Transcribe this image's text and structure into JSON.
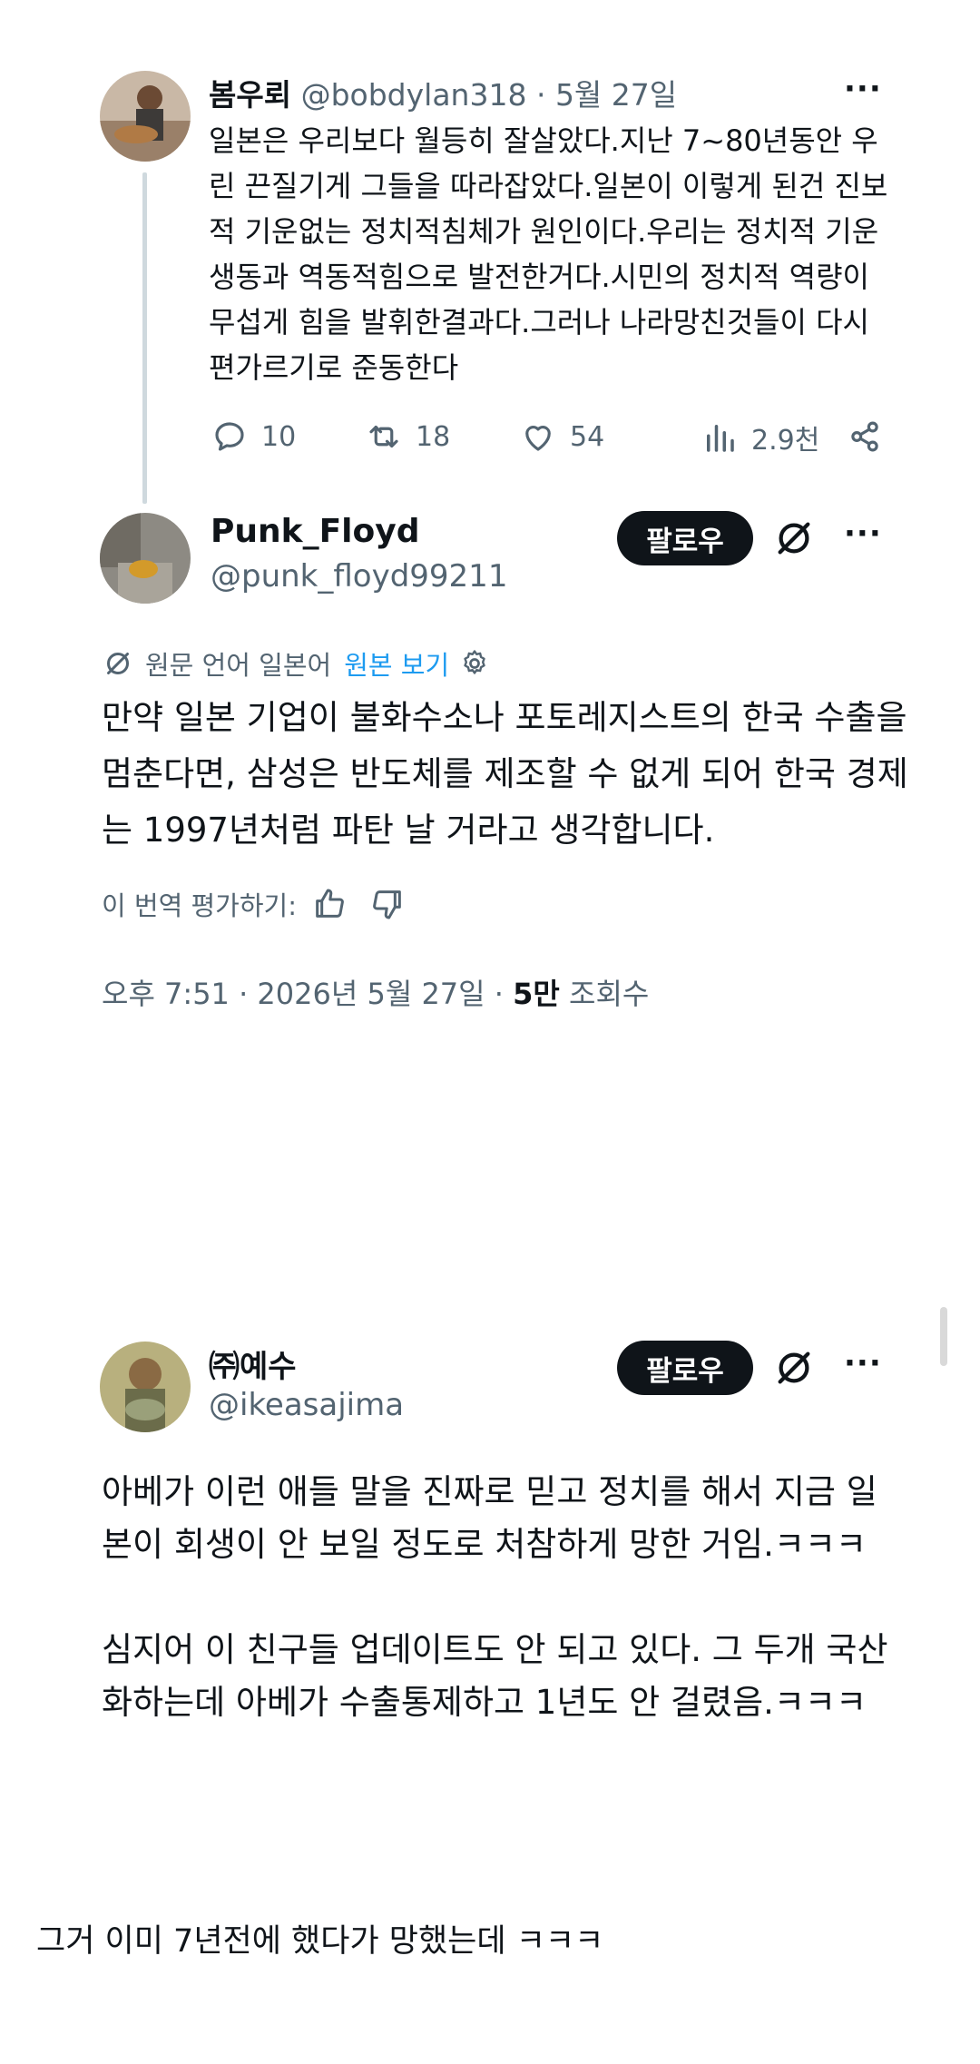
{
  "tweet1": {
    "name": "봄우뢰",
    "handle": "@bobdylan318",
    "date": "5월 27일",
    "body": "일본은 우리보다 월등히 잘살았다.지난 7~80년동안 우린 끈질기게 그들을 따라잡았다.일본이 이렇게 된건 진보적 기운없는 정치적침체가 원인이다.우리는 정치적 기운생동과 역동적힘으로 발전한거다.시민의 정치적 역량이 무섭게 힘을 발휘한결과다.그러나 나라망친것들이 다시 편가르기로 준동한다",
    "replies": "10",
    "reposts": "18",
    "likes": "54",
    "views": "2.9천"
  },
  "tweet2": {
    "name": "Punk_Floyd",
    "handle": "@punk_floyd99211",
    "follow_label": "팔로우",
    "translated_label": "원문 언어 일본어",
    "show_original": "원본 보기",
    "body": "만약 일본 기업이 불화수소나 포토레지스트의 한국 수출을 멈춘다면, 삼성은 반도체를 제조할 수 없게 되어 한국 경제는 1997년처럼 파탄 날 거라고 생각합니다.",
    "rate_label": "이 번역 평가하기:",
    "time": "오후 7:51 · 2026년 5월 27일 · ",
    "views_count": "5만",
    "views_label": "조회수"
  },
  "tweet3": {
    "name": "㈜예수",
    "handle": "@ikeasajima",
    "follow_label": "팔로우",
    "body": "아베가 이런 애들 말을 진짜로 믿고 정치를 해서 지금 일본이 회생이 안 보일 정도로 처참하게 망한 거임.ㅋㅋㅋ\n\n심지어 이 친구들 업데이트도 안 되고 있다. 그 두개 국산화하는데 아베가 수출통제하고 1년도 안 걸렸음.ㅋㅋㅋ"
  },
  "caption": "그거 이미 7년전에 했다가 망했는데 ㅋㅋㅋ",
  "icons": [
    "reply-icon",
    "repost-icon",
    "like-icon",
    "views-icon",
    "share-icon",
    "grok-icon",
    "more-icon",
    "translate-icon",
    "gear-icon",
    "thumbs-up-icon",
    "thumbs-down-icon"
  ]
}
